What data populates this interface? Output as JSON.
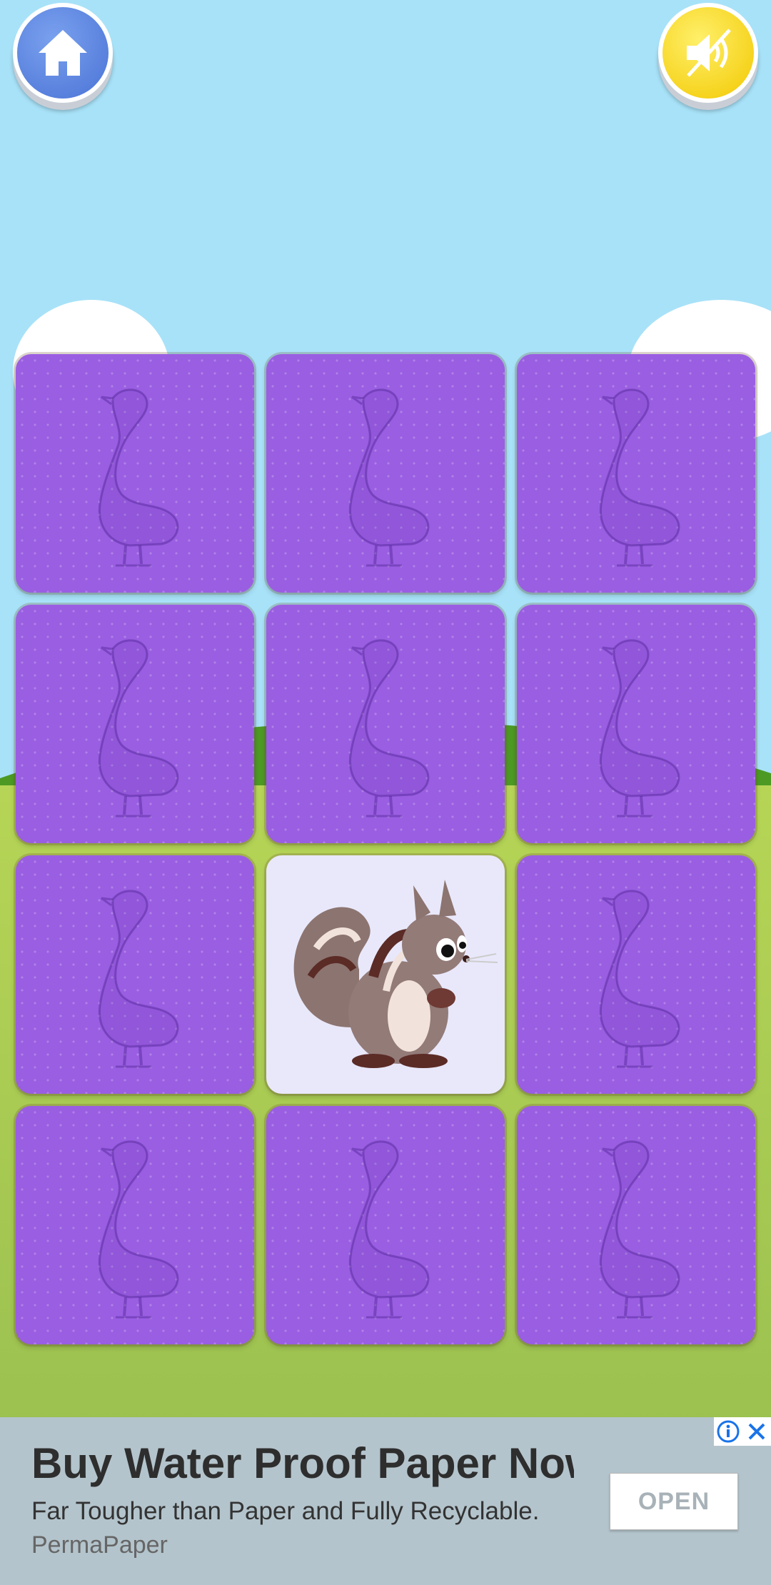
{
  "header": {
    "home_icon": "home-icon",
    "sound_icon": "sound-muted-icon"
  },
  "board": {
    "columns": 3,
    "rows": 4,
    "card_back_icon": "goose-outline-icon",
    "revealed_card_index": 7,
    "revealed_card_image": "squirrel",
    "colors": {
      "card_back": "#9a5ee2",
      "card_face": "#e9e8fb"
    }
  },
  "ad": {
    "headline": "Buy Water Proof Paper Now",
    "description": "Far Tougher than Paper and Fully Recyclable.",
    "advertiser": "PermaPaper",
    "cta_label": "OPEN",
    "info_icon": "info-icon",
    "close_icon": "close-icon"
  }
}
